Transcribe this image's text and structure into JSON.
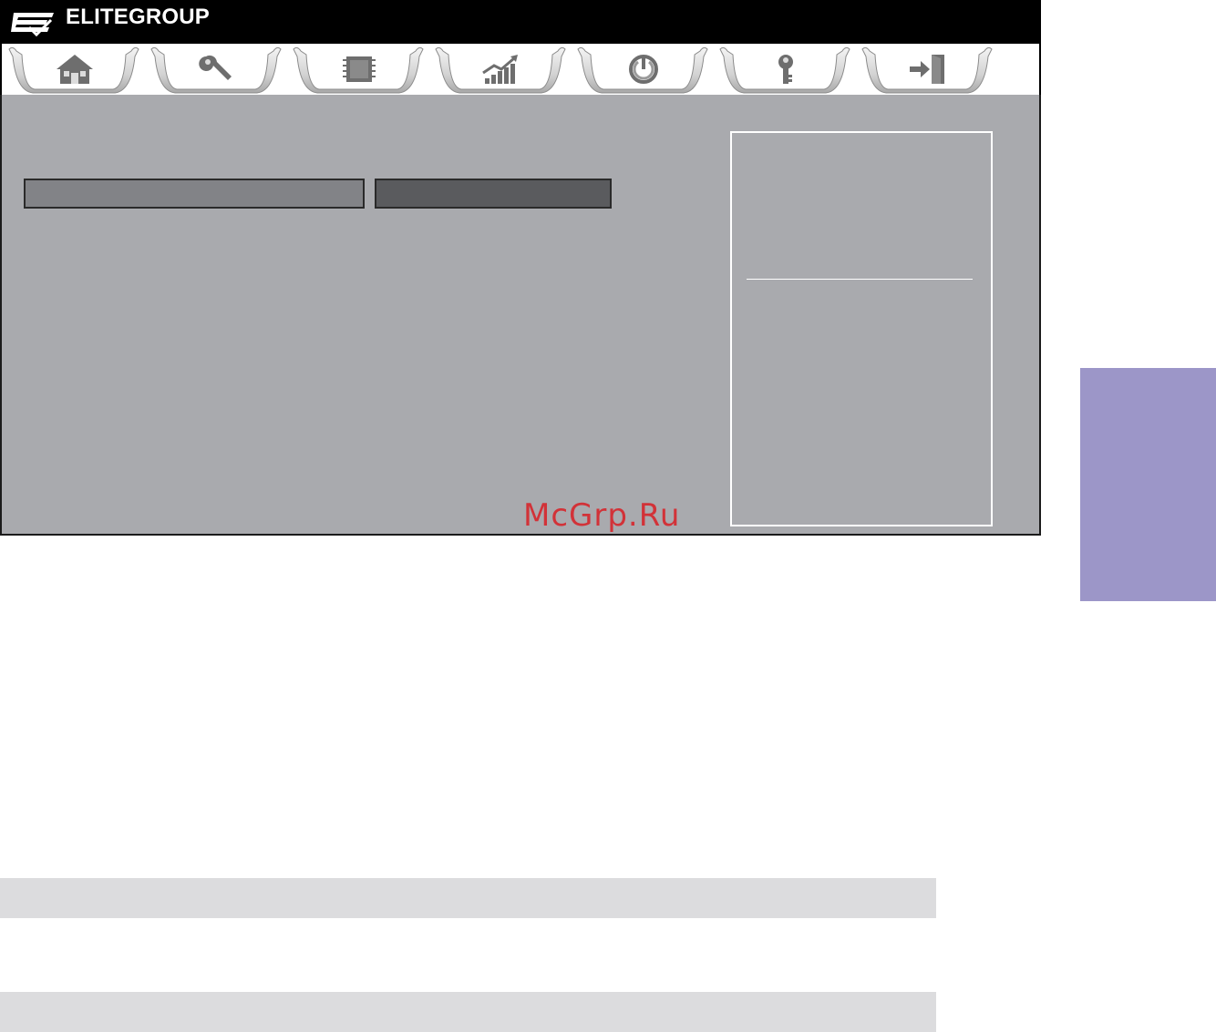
{
  "header": {
    "logo_text": "ECS",
    "brand_name": "ELITEGROUP"
  },
  "tabs": [
    {
      "icon": "home-icon"
    },
    {
      "icon": "wrench-icon"
    },
    {
      "icon": "chip-icon"
    },
    {
      "icon": "performance-chart-icon"
    },
    {
      "icon": "power-icon"
    },
    {
      "icon": "key-icon"
    },
    {
      "icon": "exit-icon"
    }
  ],
  "main": {
    "setting_label": "",
    "setting_value": ""
  },
  "watermark": "McGrp.Ru",
  "colors": {
    "header_bg": "#000000",
    "panel_bg": "#a9aaae",
    "label_box": "#828387",
    "value_box": "#5a5b5e",
    "side_tab": "#9c96c8",
    "bottom_bar": "#dcdcde",
    "watermark": "#d7262c"
  }
}
